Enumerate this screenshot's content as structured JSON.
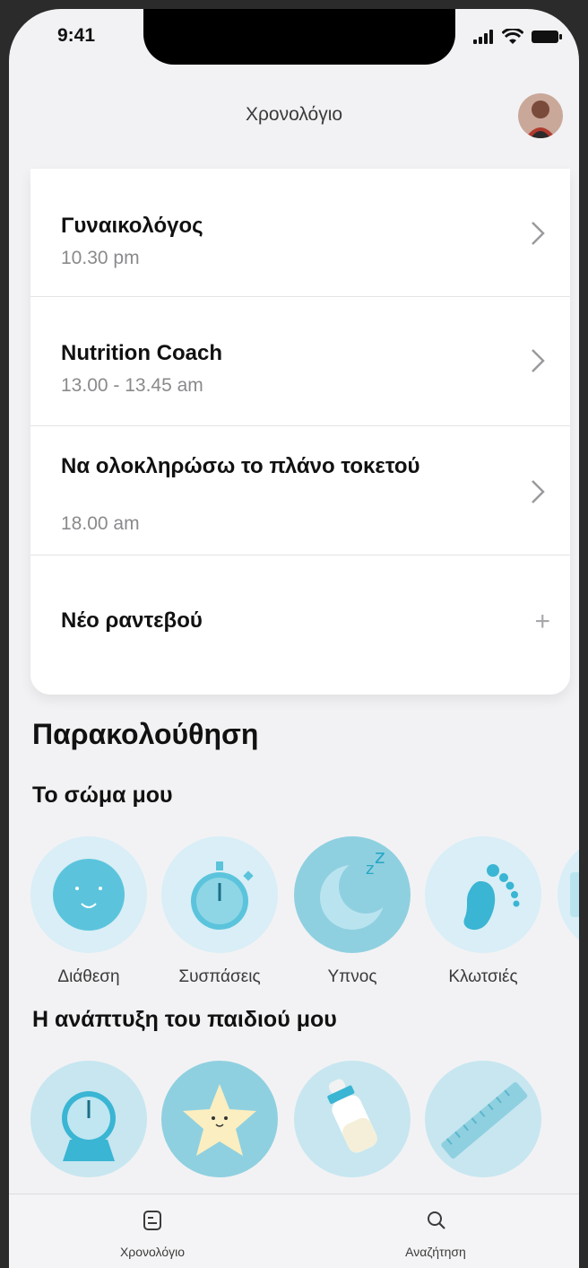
{
  "status": {
    "time": "9:41"
  },
  "nav": {
    "title": "Χρονολόγιο"
  },
  "appointments": [
    {
      "title": "Γυναικολόγος",
      "time": "10.30 pm"
    },
    {
      "title": "Nutrition Coach",
      "time": "13.00 - 13.45 am"
    },
    {
      "title": "Να ολοκληρώσω το πλάνο τοκετού",
      "time": "18.00 am"
    }
  ],
  "new_appointment_label": "Νέο ραντεβού",
  "tracking": {
    "heading": "Παρακολούθηση",
    "body_heading": "Το σώμα μου",
    "body_items": [
      {
        "label": "Διάθεση",
        "icon": "mood-face-icon"
      },
      {
        "label": "Συσπάσεις",
        "icon": "stopwatch-icon"
      },
      {
        "label": "Υπνος",
        "icon": "sleep-moon-icon"
      },
      {
        "label": "Κλωτσιές",
        "icon": "foot-icon"
      },
      {
        "label": "",
        "icon": "partial-item-icon"
      }
    ],
    "baby_heading": "Η ανάπτυξη του παιδιού μου",
    "baby_items": [
      {
        "icon": "scale-icon"
      },
      {
        "icon": "star-icon"
      },
      {
        "icon": "baby-bottle-icon"
      },
      {
        "icon": "ruler-icon"
      }
    ]
  },
  "tabbar": {
    "timeline_label": "Χρονολόγιο",
    "search_label": "Αναζήτηση"
  },
  "colors": {
    "accent": "#5bc4dc",
    "light_circle": "#d9eef6",
    "dark_circle": "#8fd0e0"
  }
}
